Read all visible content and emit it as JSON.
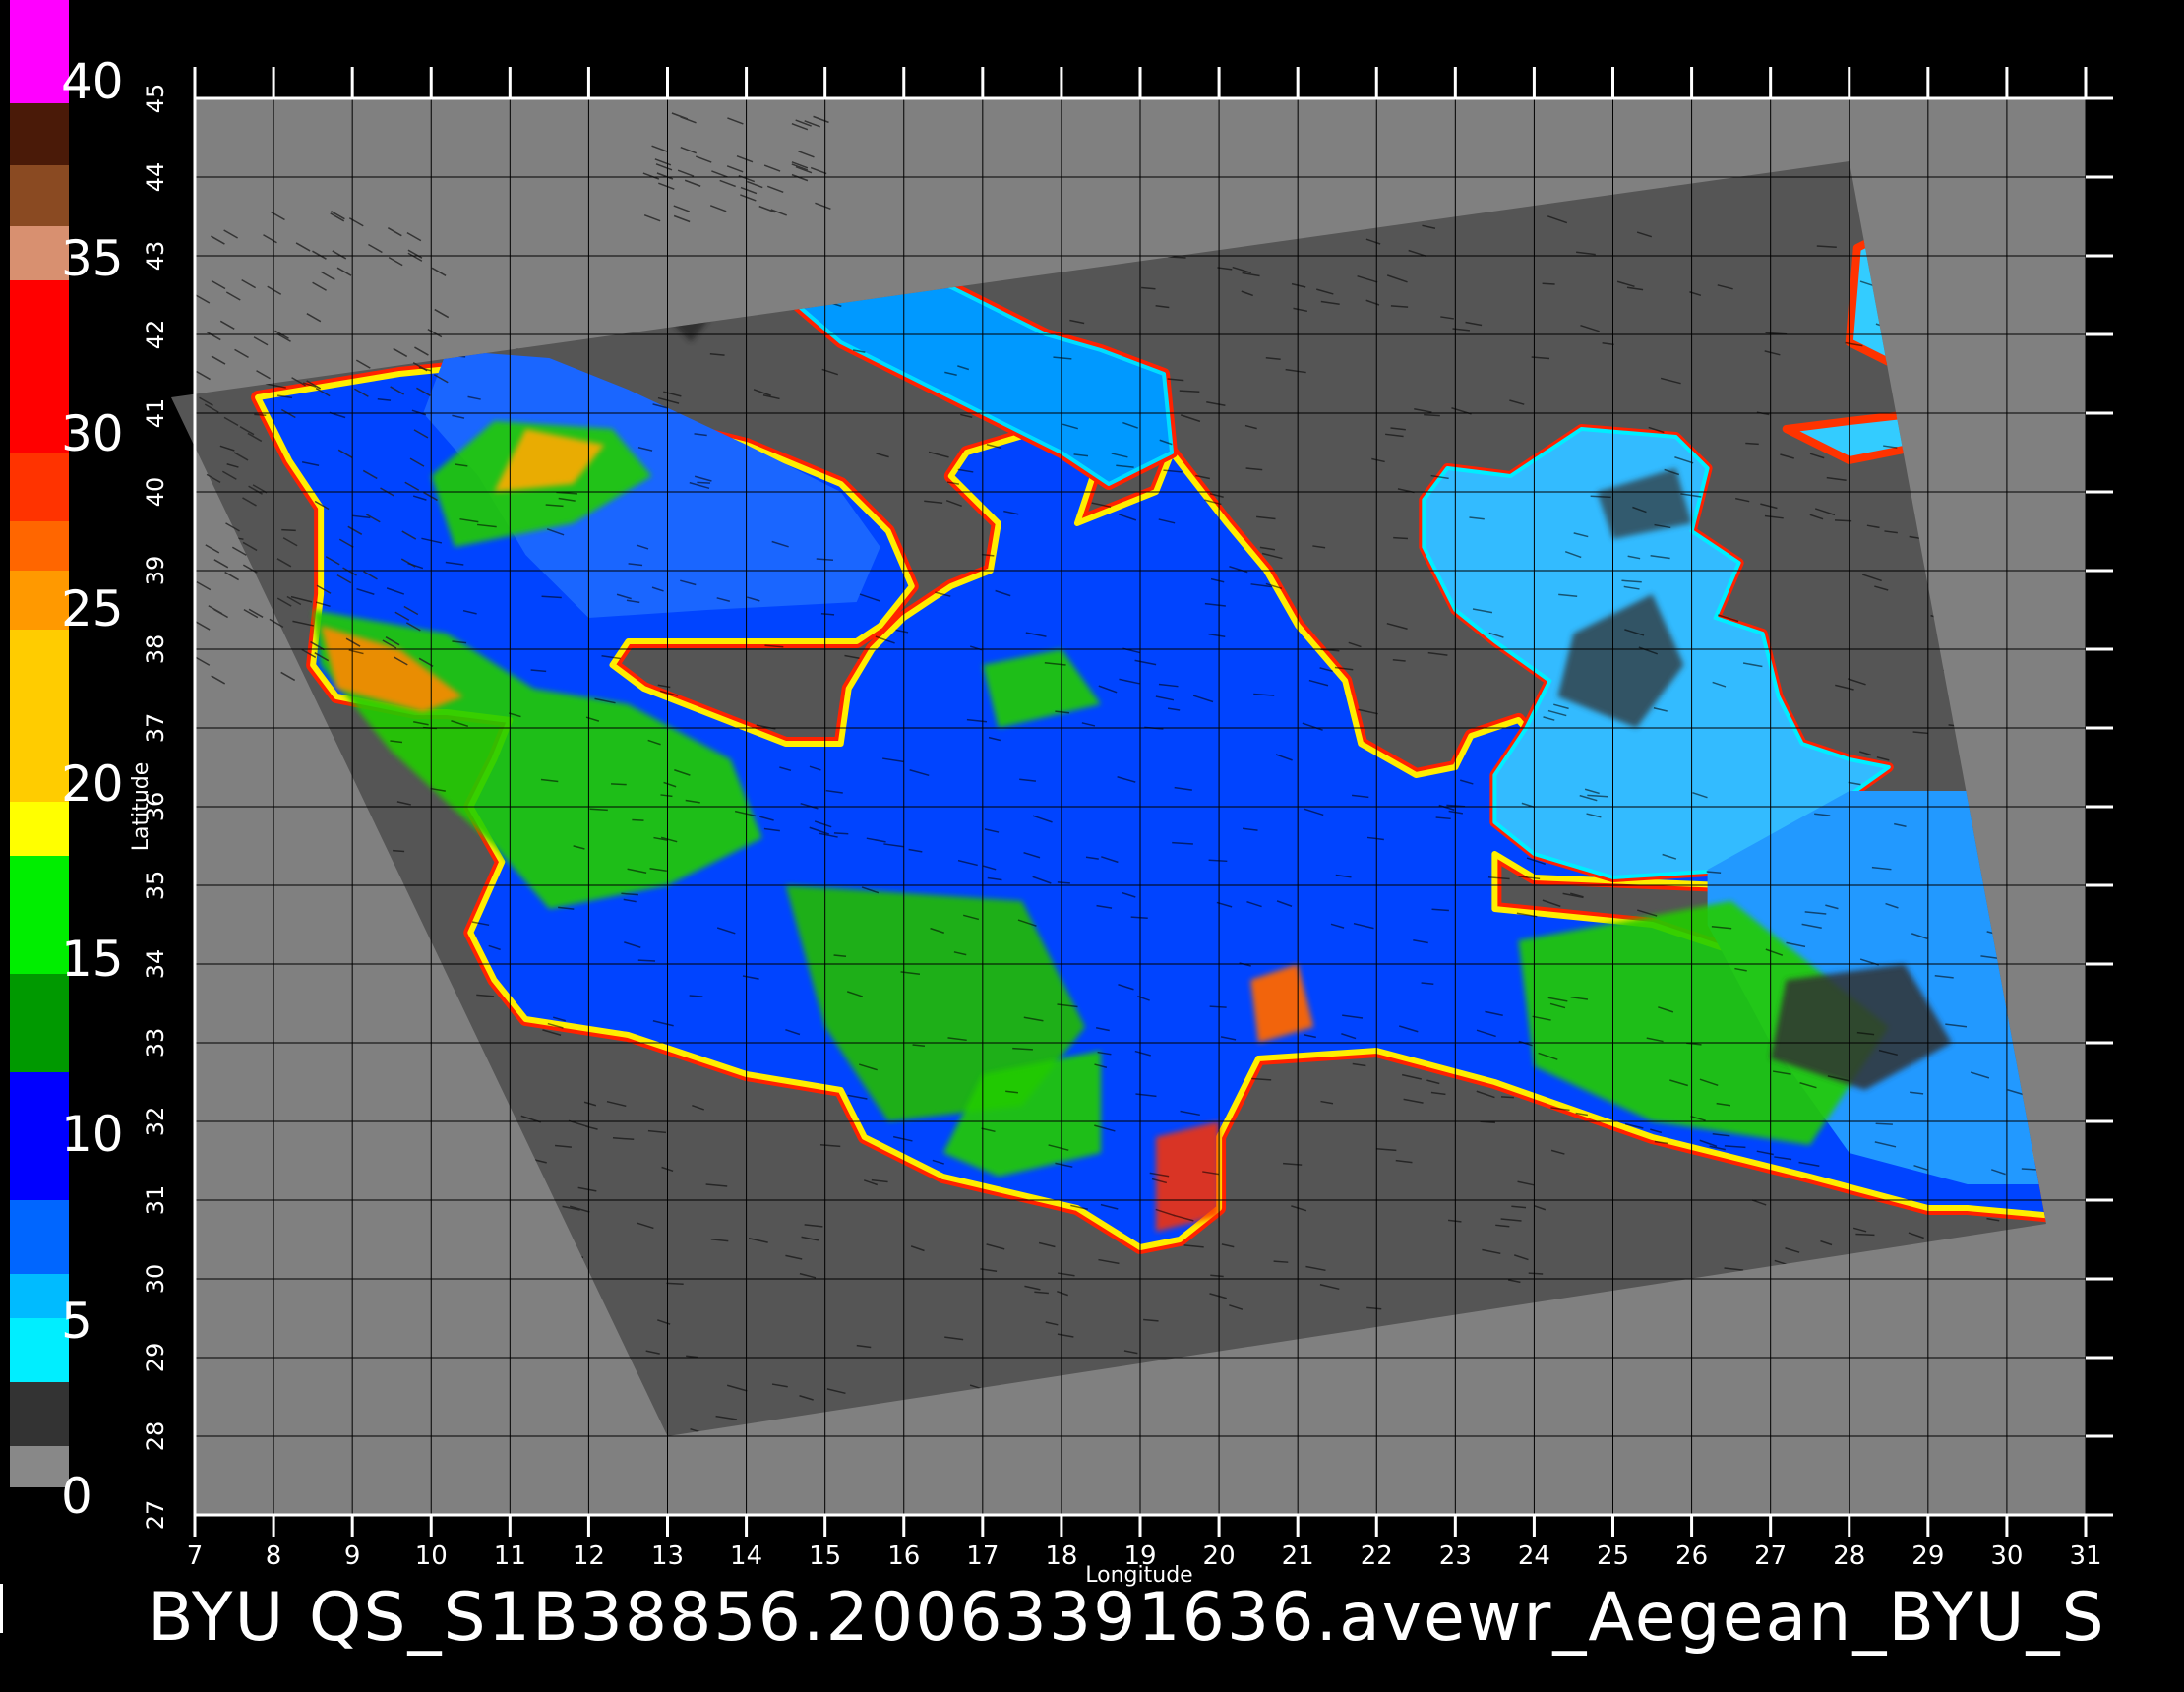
{
  "colorbar": {
    "labels": [
      "40",
      "35",
      "30",
      "25",
      "20",
      "15",
      "10",
      "5",
      "0"
    ],
    "segments": [
      {
        "color": "#ff00ff"
      },
      {
        "color": "#4a1a08"
      },
      {
        "color": "#8a4a22"
      },
      {
        "color": "#d89070"
      },
      {
        "color": "#ff0000"
      },
      {
        "color": "#ff3300"
      },
      {
        "color": "#ff6600"
      },
      {
        "color": "#ff9900"
      },
      {
        "color": "#ffcc00"
      },
      {
        "color": "#ffff00"
      },
      {
        "color": "#00ee00"
      },
      {
        "color": "#009900"
      },
      {
        "color": "#0000ff"
      },
      {
        "color": "#0066ff"
      },
      {
        "color": "#00bbff"
      },
      {
        "color": "#00eeff"
      },
      {
        "color": "#333333"
      },
      {
        "color": "#888888"
      }
    ]
  },
  "axes": {
    "xlabel": "Longitude",
    "ylabel": "Latitude",
    "x_ticks": [
      "7",
      "8",
      "9",
      "10",
      "11",
      "12",
      "13",
      "14",
      "15",
      "16",
      "17",
      "18",
      "19",
      "20",
      "21",
      "22",
      "23",
      "24",
      "25",
      "26",
      "27",
      "28",
      "29",
      "30",
      "31"
    ],
    "y_ticks": [
      "27",
      "28",
      "29",
      "30",
      "31",
      "32",
      "33",
      "34",
      "35",
      "36",
      "37",
      "38",
      "39",
      "40",
      "41",
      "42",
      "43",
      "44",
      "45"
    ],
    "xlim": [
      7,
      31
    ],
    "ylim": [
      27,
      45
    ]
  },
  "title": "BYU  QS_S1B38856.20063391636.avewr_Aegean_BYU_S",
  "colors": {
    "background": "#000000",
    "outside_swath": "#808080",
    "swath_land": "#555555",
    "grid": "#000000",
    "text": "#ffffff"
  }
}
